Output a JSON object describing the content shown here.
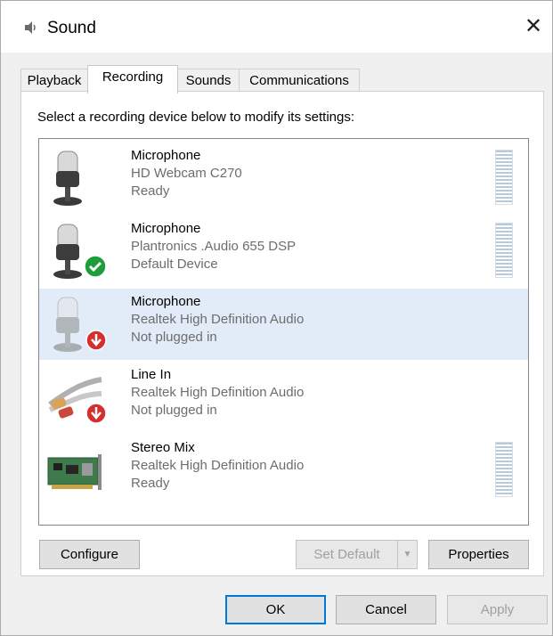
{
  "window": {
    "title": "Sound",
    "close_glyph": "✕"
  },
  "tabs": [
    {
      "label": "Playback",
      "active": false
    },
    {
      "label": "Recording",
      "active": true
    },
    {
      "label": "Sounds",
      "active": false
    },
    {
      "label": "Communications",
      "active": false
    }
  ],
  "panel": {
    "instruction": "Select a recording device below to modify its settings:"
  },
  "devices": [
    {
      "name": "Microphone",
      "description": "HD Webcam C270",
      "status": "Ready",
      "icon": "microphone-icon",
      "badge": null,
      "selected": false,
      "has_level_meter": true
    },
    {
      "name": "Microphone",
      "description": "Plantronics .Audio 655 DSP",
      "status": "Default Device",
      "icon": "microphone-icon",
      "badge": "default-check-icon",
      "selected": false,
      "has_level_meter": true
    },
    {
      "name": "Microphone",
      "description": "Realtek High Definition Audio",
      "status": "Not plugged in",
      "icon": "microphone-icon",
      "badge": "unplugged-arrow-icon",
      "selected": true,
      "has_level_meter": false
    },
    {
      "name": "Line In",
      "description": "Realtek High Definition Audio",
      "status": "Not plugged in",
      "icon": "line-in-cable-icon",
      "badge": "unplugged-arrow-icon",
      "selected": false,
      "has_level_meter": false
    },
    {
      "name": "Stereo Mix",
      "description": "Realtek High Definition Audio",
      "status": "Ready",
      "icon": "sound-card-icon",
      "badge": null,
      "selected": false,
      "has_level_meter": true
    }
  ],
  "buttons": {
    "configure": "Configure",
    "set_default": "Set Default",
    "properties": "Properties",
    "ok": "OK",
    "cancel": "Cancel",
    "apply": "Apply"
  },
  "colors": {
    "selection": "#e1ecf8",
    "default_badge": "#1e9e3a",
    "unplugged_badge": "#d32f2f",
    "focus_border": "#0078d7"
  }
}
